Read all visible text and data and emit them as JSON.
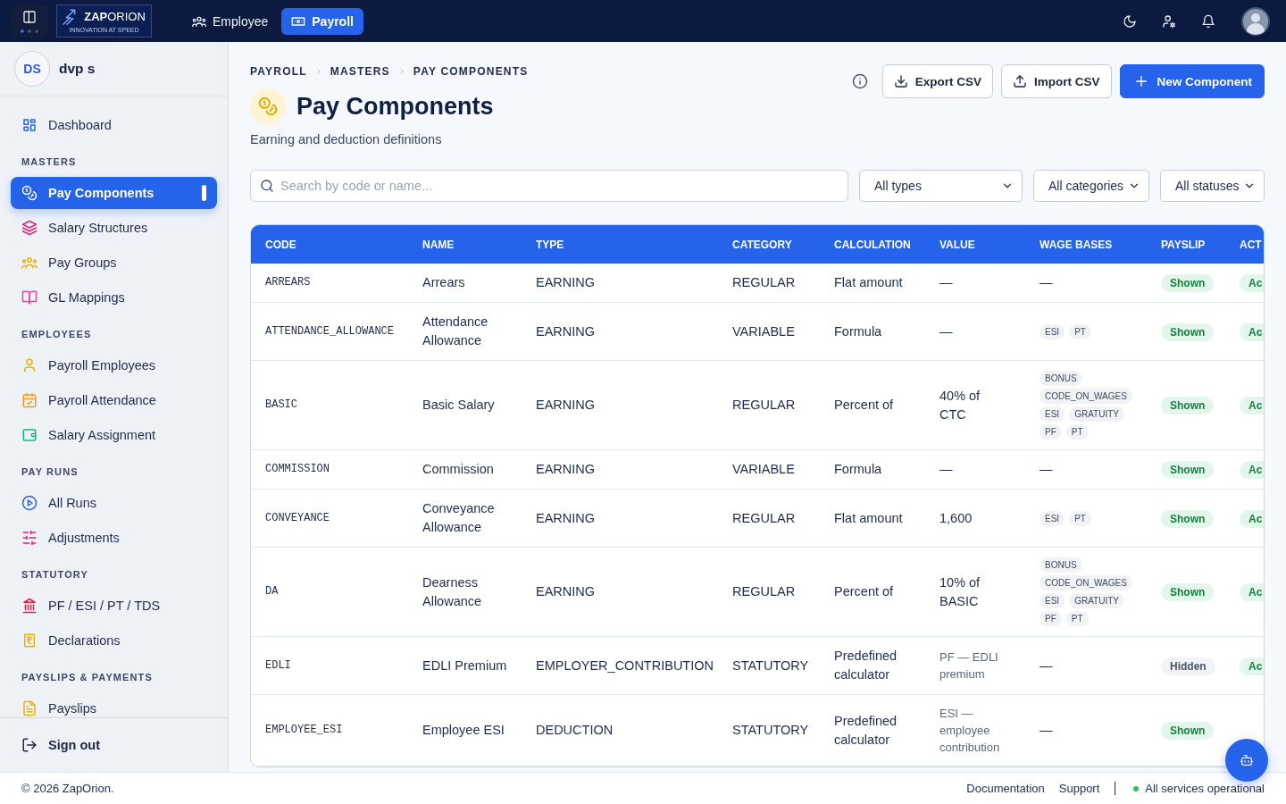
{
  "topbar": {
    "logo": {
      "wordmark": "**ZAP**ORION",
      "tagline": "INNOVATION AT SPEED"
    },
    "tabs": [
      {
        "label": "Employee",
        "selected": false
      },
      {
        "label": "Payroll",
        "selected": true
      }
    ]
  },
  "sidebar": {
    "user": {
      "initials": "DS",
      "name": "dvp s"
    },
    "sections": [
      {
        "items": [
          {
            "label": "Dashboard",
            "selected": false
          }
        ]
      },
      {
        "title": "MASTERS",
        "items": [
          {
            "label": "Pay Components",
            "selected": true
          },
          {
            "label": "Salary Structures",
            "selected": false
          },
          {
            "label": "Pay Groups",
            "selected": false
          },
          {
            "label": "GL Mappings",
            "selected": false
          }
        ]
      },
      {
        "title": "EMPLOYEES",
        "items": [
          {
            "label": "Payroll Employees",
            "selected": false
          },
          {
            "label": "Payroll Attendance",
            "selected": false
          },
          {
            "label": "Salary Assignment",
            "selected": false
          }
        ]
      },
      {
        "title": "PAY RUNS",
        "items": [
          {
            "label": "All Runs",
            "selected": false
          },
          {
            "label": "Adjustments",
            "selected": false
          }
        ]
      },
      {
        "title": "STATUTORY",
        "items": [
          {
            "label": "PF / ESI / PT / TDS",
            "selected": false
          },
          {
            "label": "Declarations",
            "selected": false
          }
        ]
      },
      {
        "title": "PAYSLIPS & PAYMENTS",
        "items": [
          {
            "label": "Payslips",
            "selected": false
          }
        ]
      }
    ],
    "sign_out": "Sign out"
  },
  "page": {
    "breadcrumb": [
      "PAYROLL",
      "MASTERS",
      "PAY COMPONENTS"
    ],
    "title": "Pay Components",
    "subtitle": "Earning and deduction definitions",
    "actions": [
      {
        "label": "Export CSV",
        "kind": "export"
      },
      {
        "label": "Import CSV",
        "kind": "import"
      },
      {
        "label": "New Component",
        "kind": "create"
      }
    ]
  },
  "filters": {
    "search": {
      "placeholder": "Search by code or name..."
    },
    "selects": [
      {
        "value": "All types"
      },
      {
        "value": "All categories"
      },
      {
        "value": "All statuses"
      }
    ]
  },
  "table": {
    "columns": [
      "CODE",
      "NAME",
      "TYPE",
      "CATEGORY",
      "CALCULATION",
      "VALUE",
      "WAGE BASES",
      "PAYSLIP",
      "ACT"
    ],
    "rows": [
      {
        "code": "ARREARS",
        "name": "Arrears",
        "type": "EARNING",
        "category": "REGULAR",
        "calculation": "Flat amount",
        "value": {
          "text": "—",
          "kind": "figure"
        },
        "wage_bases_text": "—",
        "payslip": {
          "text": "Shown",
          "shown": true
        },
        "status": {
          "text": "Ac",
          "active": true
        }
      },
      {
        "code": "ATTENDANCE_ALLOWANCE",
        "name": "Attendance Allowance",
        "type": "EARNING",
        "category": "VARIABLE",
        "calculation": "Formula",
        "value": {
          "text": "—",
          "kind": "figure"
        },
        "wage_bases": [
          "ESI",
          "PT"
        ],
        "payslip": {
          "text": "Shown",
          "shown": true
        },
        "status": {
          "text": "Ac",
          "active": true
        }
      },
      {
        "code": "BASIC",
        "name": "Basic Salary",
        "type": "EARNING",
        "category": "REGULAR",
        "calculation": "Percent of",
        "value": {
          "text": "40% of CTC",
          "kind": "figure"
        },
        "wage_bases": [
          "BONUS",
          "CODE_ON_WAGES",
          "ESI",
          "GRATUITY",
          "PF",
          "PT"
        ],
        "payslip": {
          "text": "Shown",
          "shown": true
        },
        "status": {
          "text": "Ac",
          "active": true
        }
      },
      {
        "code": "COMMISSION",
        "name": "Commission",
        "type": "EARNING",
        "category": "VARIABLE",
        "calculation": "Formula",
        "value": {
          "text": "—",
          "kind": "figure"
        },
        "wage_bases_text": "—",
        "payslip": {
          "text": "Shown",
          "shown": true
        },
        "status": {
          "text": "Ac",
          "active": true
        }
      },
      {
        "code": "CONVEYANCE",
        "name": "Conveyance Allowance",
        "type": "EARNING",
        "category": "REGULAR",
        "calculation": "Flat amount",
        "value": {
          "text": "1,600",
          "kind": "figure"
        },
        "wage_bases": [
          "ESI",
          "PT"
        ],
        "payslip": {
          "text": "Shown",
          "shown": true
        },
        "status": {
          "text": "Ac",
          "active": true
        }
      },
      {
        "code": "DA",
        "name": "Dearness Allowance",
        "type": "EARNING",
        "category": "REGULAR",
        "calculation": "Percent of",
        "value": {
          "text": "10% of BASIC",
          "kind": "figure"
        },
        "wage_bases": [
          "BONUS",
          "CODE_ON_WAGES",
          "ESI",
          "GRATUITY",
          "PF",
          "PT"
        ],
        "payslip": {
          "text": "Shown",
          "shown": true
        },
        "status": {
          "text": "Ac",
          "active": true
        }
      },
      {
        "code": "EDLI",
        "name": "EDLI Premium",
        "type": "EMPLOYER_CONTRIBUTION",
        "category": "STATUTORY",
        "calculation": "Predefined calculator",
        "value": {
          "text": "PF — EDLI premium",
          "kind": "note"
        },
        "wage_bases_text": "—",
        "payslip": {
          "text": "Hidden",
          "shown": false
        },
        "status": {
          "text": "Ac",
          "active": true
        }
      },
      {
        "code": "EMPLOYEE_ESI",
        "name": "Employee ESI",
        "type": "DEDUCTION",
        "category": "STATUTORY",
        "calculation": "Predefined calculator",
        "value": {
          "text": "ESI — employee contribution",
          "kind": "note"
        },
        "wage_bases_text": "—",
        "payslip": {
          "text": "Shown",
          "shown": true
        }
      }
    ]
  },
  "footer": {
    "copyright": "© 2026 ZapOrion.",
    "links": [
      "Documentation",
      "Support"
    ],
    "status": {
      "text": "All services operational",
      "healthy": true
    }
  }
}
